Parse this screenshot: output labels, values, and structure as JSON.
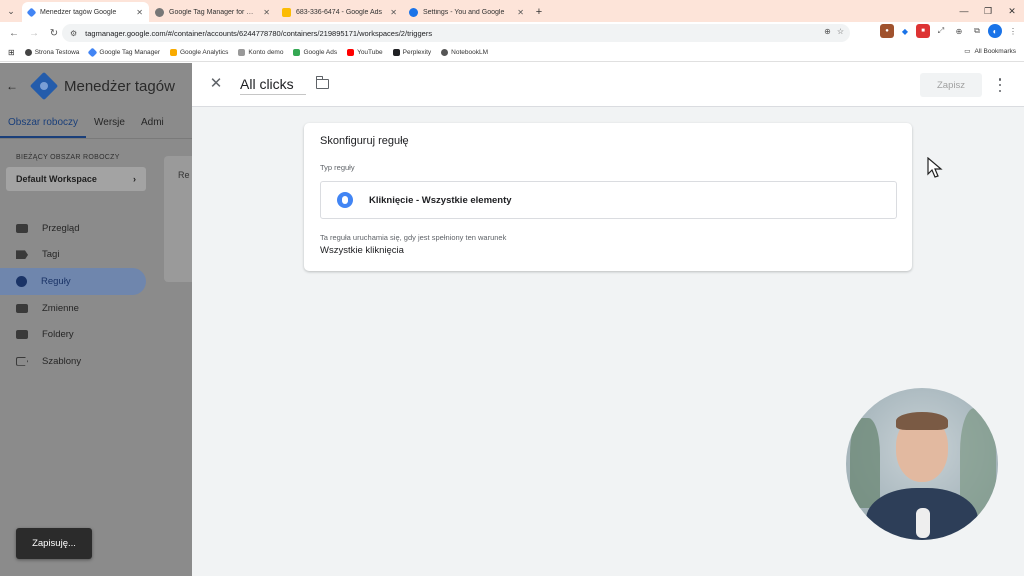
{
  "browser": {
    "tabs": [
      {
        "title": "Menedżer tagów Google",
        "icon_color": "#4285f4",
        "active": true
      },
      {
        "title": "Google Tag Manager for WordP",
        "icon_color": "#5f6368",
        "active": false
      },
      {
        "title": "683-336-6474 - Google Ads",
        "icon_color": "#fbbc04",
        "active": false
      },
      {
        "title": "Settings - You and Google",
        "icon_color": "#1a73e8",
        "active": false
      }
    ],
    "tab_close": "✕",
    "new_tab": "+",
    "url": "tagmanager.google.com/#/container/accounts/6244778780/containers/219895171/workspaces/2/triggers",
    "bookmarks": [
      {
        "label": "Strona Testowa",
        "color": "#444"
      },
      {
        "label": "Google Tag Manager",
        "color": "#4285f4"
      },
      {
        "label": "Google Analytics",
        "color": "#f9ab00"
      },
      {
        "label": "Konto demo",
        "color": "#999"
      },
      {
        "label": "Google Ads",
        "color": "#34a853"
      },
      {
        "label": "YouTube",
        "color": "#ff0000"
      },
      {
        "label": "Perplexity",
        "color": "#202124"
      },
      {
        "label": "NotebookLM",
        "color": "#555"
      }
    ],
    "all_bookmarks": "All Bookmarks"
  },
  "gtm": {
    "app_title": "Menedżer tagów",
    "tabs": [
      "Obszar roboczy",
      "Wersje",
      "Admi"
    ],
    "workspace_label": "BIEŻĄCY OBSZAR ROBOCZY",
    "workspace_name": "Default Workspace",
    "nav": [
      {
        "label": "Przegląd",
        "active": false
      },
      {
        "label": "Tagi",
        "active": false
      },
      {
        "label": "Reguły",
        "active": true
      },
      {
        "label": "Zmienne",
        "active": false
      },
      {
        "label": "Foldery",
        "active": false
      },
      {
        "label": "Szablony",
        "active": false
      }
    ],
    "content_peek": "Re",
    "toast": "Zapisuję..."
  },
  "editor": {
    "trigger_name": "All clicks",
    "save_label": "Zapisz",
    "card_title": "Skonfiguruj regułę",
    "type_label": "Typ reguły",
    "type_name": "Kliknięcie - Wszystkie elementy",
    "condition_label": "Ta reguła uruchamia się, gdy jest spełniony ten warunek",
    "condition_value": "Wszystkie kliknięcia"
  },
  "colors": {
    "accent": "#1a73e8",
    "gtm_blue": "#245cab",
    "overlay_gray": "#8b8b8b",
    "tabbar": "#fde4d9"
  }
}
